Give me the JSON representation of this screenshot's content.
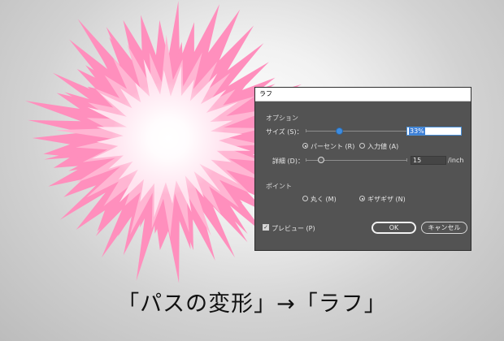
{
  "caption": "「パスの変形」→「ラフ」",
  "canvas": {
    "flower_colors": {
      "outer": "#ff8fbd",
      "mid": "#ffb6d3",
      "inner": "#ffe3ef",
      "center": "#ffffff"
    }
  },
  "dialog": {
    "title": "ラフ",
    "options_label": "オプション",
    "size_label": "サイズ (S)：",
    "size_value": "33%",
    "percent_label": "パーセント (R)",
    "absolute_label": "入力値 (A)",
    "detail_label": "詳細 (D)：",
    "detail_value": "15",
    "detail_unit": "/inch",
    "points_label": "ポイント",
    "smooth_label": "丸く (M)",
    "corner_label": "ギザギザ (N)",
    "preview_label": "プレビュー (P)",
    "ok_label": "OK",
    "cancel_label": "キャンセル",
    "size_mode_selected": "percent",
    "point_type_selected": "corner",
    "preview_checked": true,
    "size_slider_fraction": 0.33,
    "detail_slider_fraction": 0.15,
    "accent_color": "#3d8ce0"
  }
}
